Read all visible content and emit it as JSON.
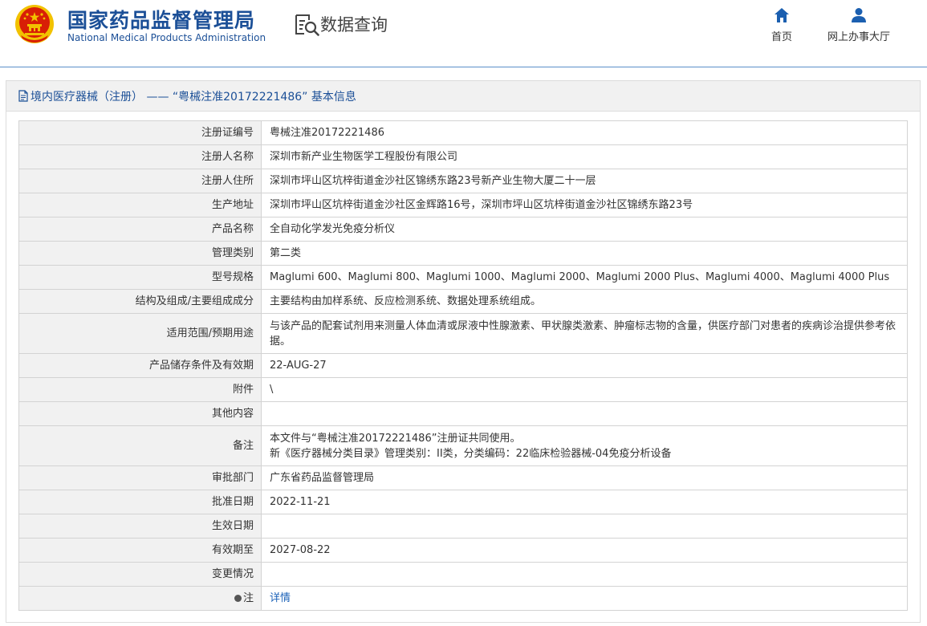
{
  "header": {
    "logo_cn": "国家药品监督管理局",
    "logo_en": "National Medical Products Administration",
    "query_label": "数据查询",
    "nav": [
      {
        "label": "首页",
        "icon": "home-icon"
      },
      {
        "label": "网上办事大厅",
        "icon": "user-icon"
      }
    ]
  },
  "panel": {
    "title": "境内医疗器械（注册） —— “粤械注准20172221486” 基本信息"
  },
  "rows": [
    {
      "label": "注册证编号",
      "value": "粤械注准20172221486"
    },
    {
      "label": "注册人名称",
      "value": "深圳市新产业生物医学工程股份有限公司"
    },
    {
      "label": "注册人住所",
      "value": "深圳市坪山区坑梓街道金沙社区锦绣东路23号新产业生物大厦二十一层"
    },
    {
      "label": "生产地址",
      "value": "深圳市坪山区坑梓街道金沙社区金辉路16号，深圳市坪山区坑梓街道金沙社区锦绣东路23号"
    },
    {
      "label": "产品名称",
      "value": "全自动化学发光免疫分析仪"
    },
    {
      "label": "管理类别",
      "value": "第二类"
    },
    {
      "label": "型号规格",
      "value": "Maglumi 600、Maglumi 800、Maglumi 1000、Maglumi 2000、Maglumi 2000 Plus、Maglumi 4000、Maglumi 4000 Plus"
    },
    {
      "label": "结构及组成/主要组成成分",
      "value": "主要结构由加样系统、反应检测系统、数据处理系统组成。"
    },
    {
      "label": "适用范围/预期用途",
      "value": "与该产品的配套试剂用来测量人体血清或尿液中性腺激素、甲状腺类激素、肿瘤标志物的含量，供医疗部门对患者的疾病诊治提供参考依据。"
    },
    {
      "label": "产品储存条件及有效期",
      "value": "22-AUG-27"
    },
    {
      "label": "附件",
      "value": "\\"
    },
    {
      "label": "其他内容",
      "value": ""
    },
    {
      "label": "备注",
      "value_line1": "本文件与“粤械注准20172221486”注册证共同使用。",
      "value_line2": "新《医疗器械分类目录》管理类别：II类，分类编码：22临床检验器械-04免疫分析设备"
    },
    {
      "label": "审批部门",
      "value": "广东省药品监督管理局"
    },
    {
      "label": "批准日期",
      "value": "2022-11-21"
    },
    {
      "label": "生效日期",
      "value": ""
    },
    {
      "label": "有效期至",
      "value": "2027-08-22"
    },
    {
      "label": "变更情况",
      "value": ""
    },
    {
      "label": "注",
      "value": "详情",
      "icon": "bullet-icon"
    }
  ],
  "colors": {
    "brand_blue": "#1b4f97",
    "link_blue": "#1b62b8",
    "label_bg": "#f1f1f1",
    "emblem_red": "#d81e06",
    "emblem_gold": "#f2c200"
  }
}
